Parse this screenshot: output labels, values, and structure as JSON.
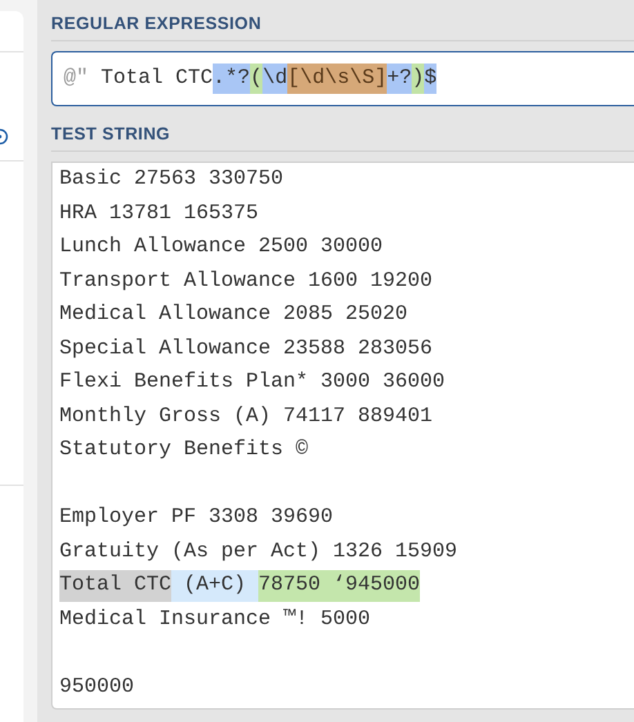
{
  "regex": {
    "heading": "REGULAR EXPRESSION",
    "tokens": [
      {
        "text": "@\"",
        "kind": "delimiter"
      },
      {
        "text": " Total CTC",
        "kind": "literal"
      },
      {
        "text": ".*?",
        "kind": "quantifier"
      },
      {
        "text": "(",
        "kind": "group"
      },
      {
        "text": "\\d",
        "kind": "quantifier"
      },
      {
        "text": "[\\d\\s\\S]",
        "kind": "class"
      },
      {
        "text": "+?",
        "kind": "quantifier"
      },
      {
        "text": ")",
        "kind": "group"
      },
      {
        "text": "$",
        "kind": "quantifier"
      }
    ]
  },
  "test": {
    "heading": "TEST STRING",
    "lines": [
      {
        "kind": "text",
        "text": "Basic 27563 330750"
      },
      {
        "kind": "text",
        "text": "HRA 13781 165375"
      },
      {
        "kind": "text",
        "text": "Lunch Allowance 2500 30000"
      },
      {
        "kind": "text",
        "text": "Transport Allowance 1600 19200"
      },
      {
        "kind": "text",
        "text": "Medical Allowance 2085 25020"
      },
      {
        "kind": "text",
        "text": "Special Allowance 23588 283056"
      },
      {
        "kind": "text",
        "text": "Flexi Benefits Plan* 3000 36000"
      },
      {
        "kind": "text",
        "text": "Monthly Gross (A) 74117 889401"
      },
      {
        "kind": "text",
        "text": "Statutory Benefits ©"
      },
      {
        "kind": "blank"
      },
      {
        "kind": "text",
        "text": "Employer PF 3308 39690"
      },
      {
        "kind": "text",
        "text": "Gratuity (As per Act) 1326 15909"
      },
      {
        "kind": "highlighted",
        "segments": [
          {
            "text": "Total CTC",
            "kind": "literal"
          },
          {
            "text": " (A+C) ",
            "kind": "match"
          },
          {
            "text": "78750 ‘945000",
            "kind": "group"
          }
        ]
      },
      {
        "kind": "text",
        "text": "Medical Insurance ™! 5000"
      },
      {
        "kind": "blank"
      },
      {
        "kind": "text",
        "text": "950000"
      }
    ]
  }
}
